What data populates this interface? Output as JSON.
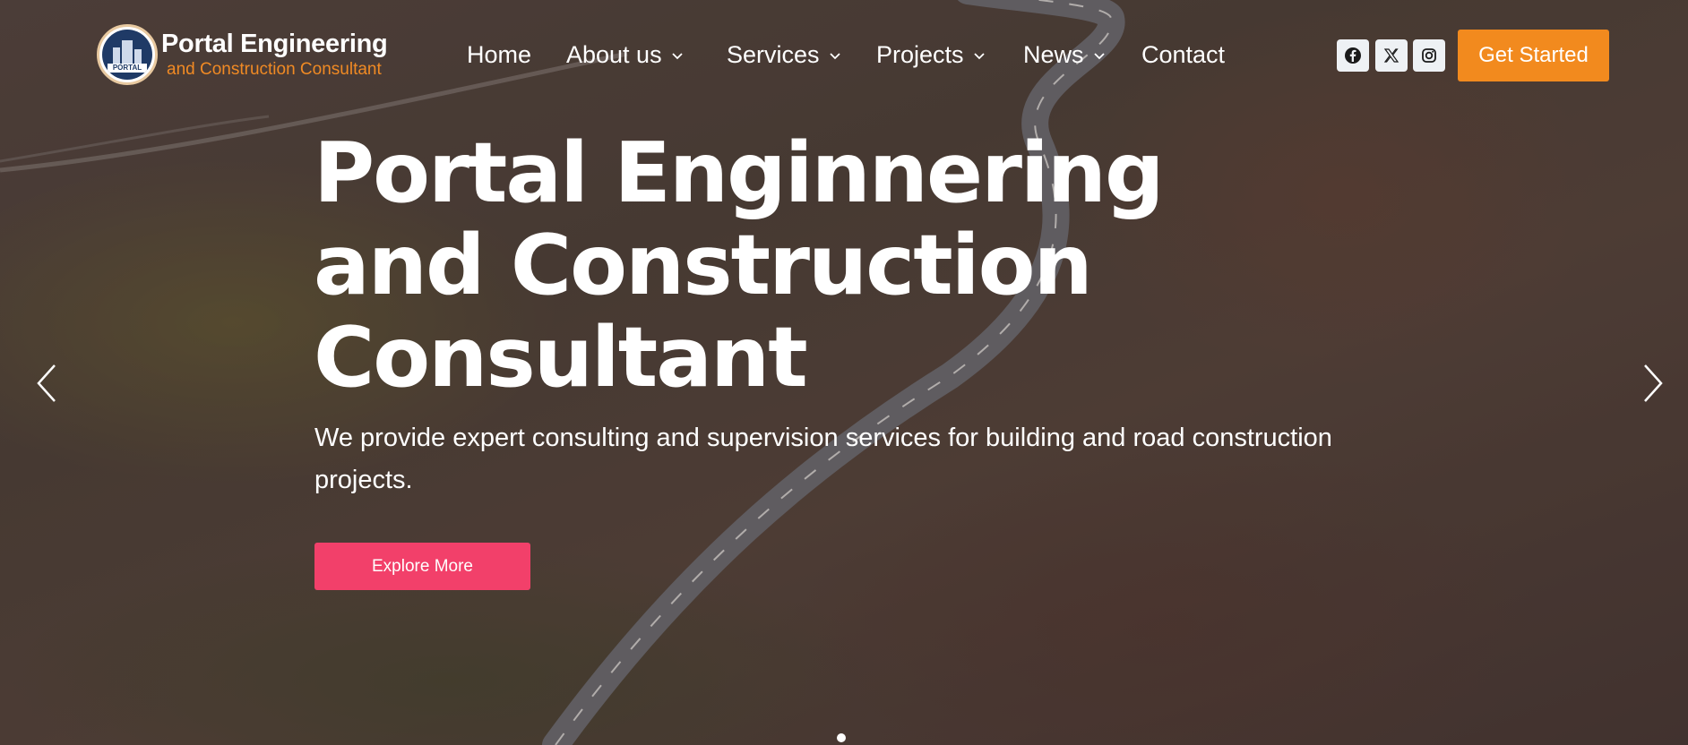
{
  "header": {
    "logo": {
      "badge_text": "PORTAL",
      "title": "Portal Engineering",
      "subtitle": "and Construction Consultant"
    },
    "nav": [
      {
        "label": "Home",
        "has_dropdown": false
      },
      {
        "label": "About us",
        "has_dropdown": true
      },
      {
        "label": "Services",
        "has_dropdown": true
      },
      {
        "label": "Projects",
        "has_dropdown": true
      },
      {
        "label": "News",
        "has_dropdown": true
      },
      {
        "label": "Contact",
        "has_dropdown": false
      }
    ],
    "social": [
      {
        "icon": "facebook-icon"
      },
      {
        "icon": "x-twitter-icon"
      },
      {
        "icon": "instagram-icon"
      }
    ],
    "cta_label": "Get Started"
  },
  "hero": {
    "title_lines": [
      "Portal Enginnering",
      "and Construction",
      "Consultant"
    ],
    "subtitle": "We provide expert consulting and supervision services for building and road construction projects.",
    "button_label": "Explore More",
    "slider": {
      "current_slide": 1
    }
  },
  "colors": {
    "accent_orange": "#f28a1e",
    "accent_pink": "#f2406a",
    "logo_navy": "#1f3a66"
  }
}
